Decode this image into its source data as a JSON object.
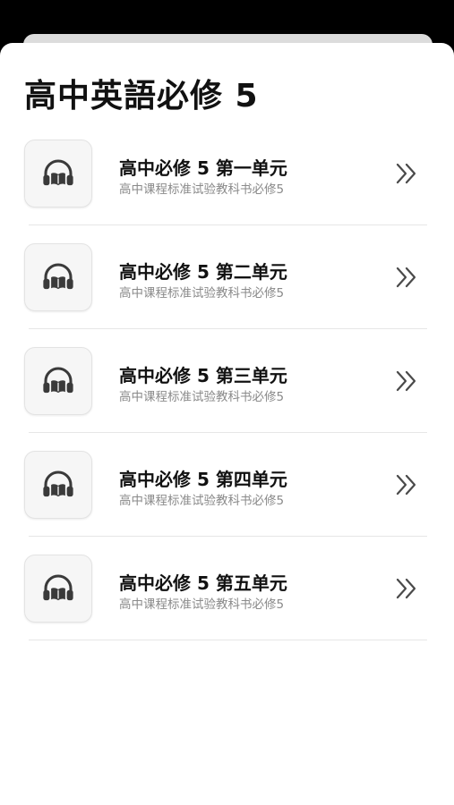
{
  "page": {
    "title": "高中英語必修 5"
  },
  "units": [
    {
      "title": "高中必修 5 第一单元",
      "subtitle": "高中课程标准试验教科书必修5"
    },
    {
      "title": "高中必修 5 第二单元",
      "subtitle": "高中课程标准试验教科书必修5"
    },
    {
      "title": "高中必修 5 第三单元",
      "subtitle": "高中课程标准试验教科书必修5"
    },
    {
      "title": "高中必修 5 第四单元",
      "subtitle": "高中课程标准试验教科书必修5"
    },
    {
      "title": "高中必修 5 第五单元",
      "subtitle": "高中课程标准试验教科书必修5"
    }
  ],
  "icons": {
    "thumbnail": "audiobook-headphones-icon",
    "chevron": "double-chevron-right-icon"
  },
  "colors": {
    "title": "#111111",
    "subtitle": "#8a8a8a",
    "icon": "#3a3a3a",
    "divider": "#e6e6e6"
  }
}
